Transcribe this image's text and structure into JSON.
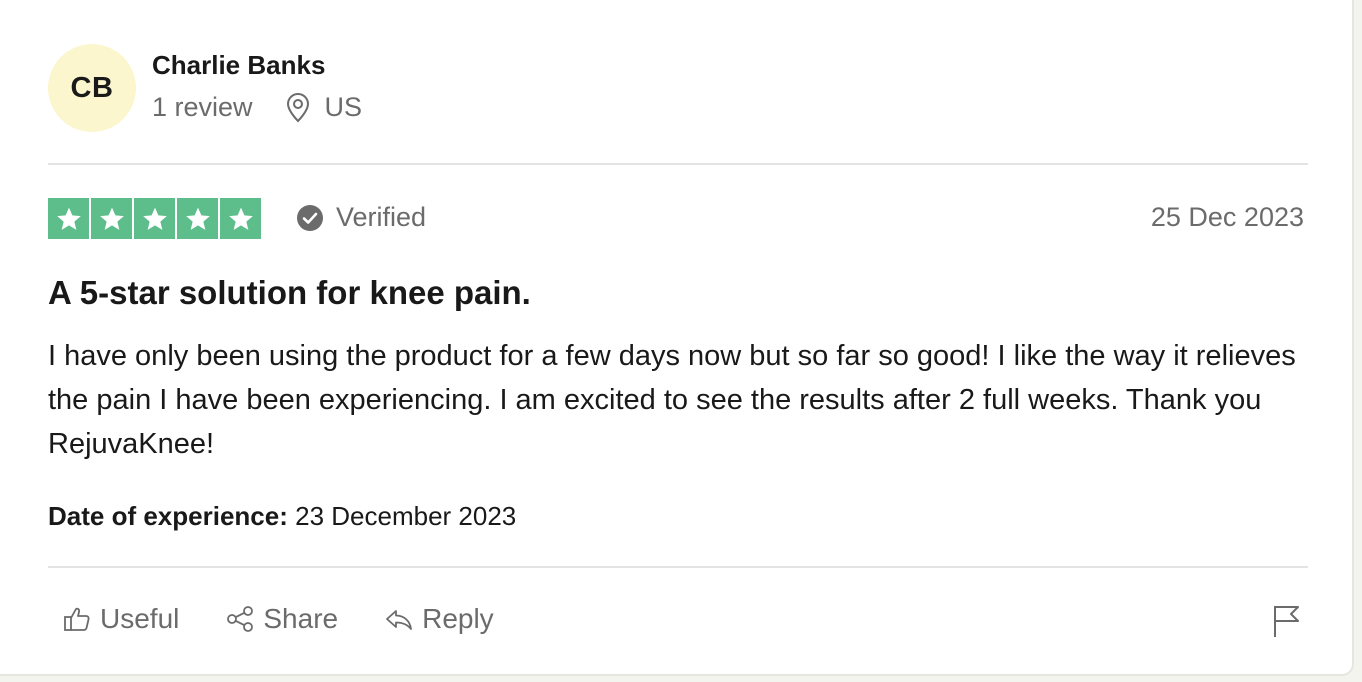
{
  "reviewer": {
    "initials": "CB",
    "name": "Charlie Banks",
    "review_count": "1 review",
    "location": "US",
    "avatar_color": "#fbf6cd"
  },
  "rating": {
    "stars": 5,
    "max": 5,
    "color": "#5dbe8c",
    "verified_label": "Verified"
  },
  "review": {
    "date": "25 Dec 2023",
    "title": "A 5-star solution for knee pain.",
    "body": "I have only been using the product for a few days now but so far so good! I like the way it relieves the pain I have been experiencing. I am excited to see the results after 2 full weeks. Thank you RejuvaKnee!",
    "experience_label": "Date of experience:",
    "experience_date": "23 December 2023"
  },
  "actions": {
    "useful": "Useful",
    "share": "Share",
    "reply": "Reply"
  },
  "icons": {
    "location": "location-pin-icon",
    "verified": "checkmark-circle-icon",
    "useful": "thumbs-up-icon",
    "share": "share-icon",
    "reply": "reply-arrow-icon",
    "flag": "flag-icon"
  }
}
